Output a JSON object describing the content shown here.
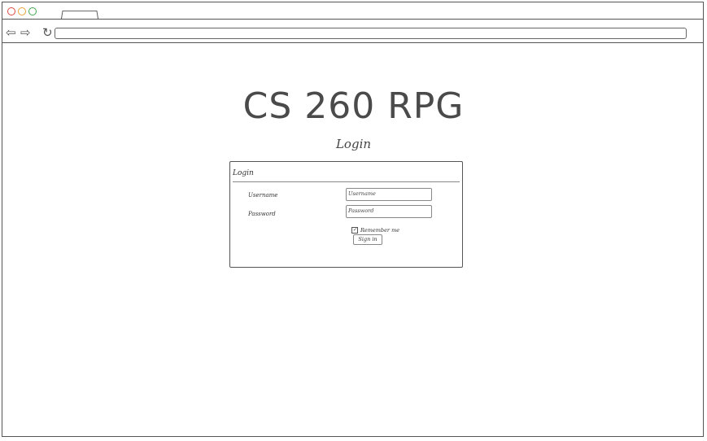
{
  "page": {
    "title": "CS 260 RPG",
    "subtitle": "Login"
  },
  "login_panel": {
    "header": "Login",
    "username_label": "Username",
    "username_placeholder": "Username",
    "password_label": "Password",
    "password_placeholder": "Password",
    "remember_label": "Remember me",
    "remember_checked": true,
    "signin_label": "Sign in"
  },
  "icons": {
    "back": "back-arrow-icon",
    "forward": "forward-arrow-icon",
    "reload": "reload-icon"
  }
}
